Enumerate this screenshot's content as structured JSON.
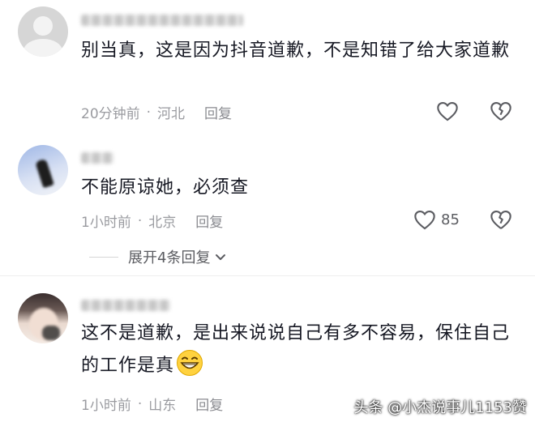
{
  "comments": [
    {
      "text": "别当真，这是因为抖音道歉，不是知错了给大家道歉",
      "time": "20分钟前",
      "location": "河北",
      "reply": "回复"
    },
    {
      "text": "不能原谅她，必须查",
      "time": "1小时前",
      "location": "北京",
      "reply": "回复",
      "likes": "85"
    },
    {
      "text": "这不是道歉，是出来说说自己有多不容易，保住自己的工作是真",
      "time": "1小时前",
      "location": "山东",
      "reply": "回复"
    }
  ],
  "expand_replies": "展开4条回复",
  "icons": {
    "like": "heart-outline-icon",
    "dislike": "broken-heart-icon",
    "expand": "chevron-down-icon",
    "emoji": "grinning-emoji"
  },
  "colors": {
    "text": "#161823",
    "meta": "#9a9ba0",
    "icon": "#5b5c61"
  },
  "watermark": "头条 @小杰说事儿1153赞"
}
